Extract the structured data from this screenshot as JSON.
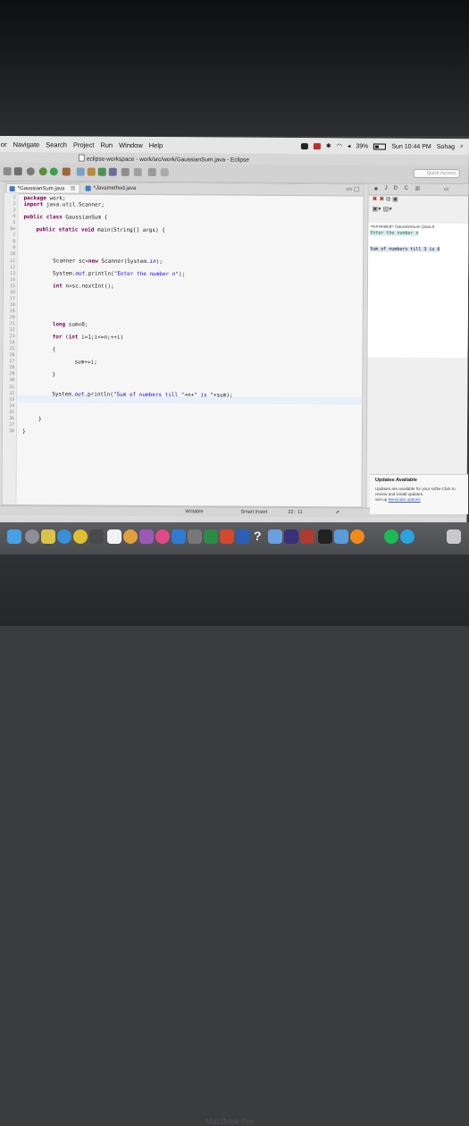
{
  "menubar": {
    "items": [
      "or",
      "Navigate",
      "Search",
      "Project",
      "Run",
      "Window",
      "Help"
    ],
    "battery": "39%",
    "clock": "Sun 10:44 PM",
    "user": "Sohag"
  },
  "window": {
    "title": "eclipse-workspace - work/src/work/GaussianSum.java - Eclipse",
    "quick_access_placeholder": "Quick Access"
  },
  "editor": {
    "tabs": [
      {
        "label": "*GaussianSum.java",
        "close": "☒",
        "active": true
      },
      {
        "label": "*Javamethod.java",
        "active": false
      }
    ],
    "line_numbers": [
      "1",
      "2",
      "3",
      "4",
      "5",
      "6⊖",
      "7",
      "8",
      "9",
      "10",
      "11",
      "12",
      "13",
      "14",
      "15",
      "16",
      "17",
      "18",
      "19",
      "20",
      "21",
      "22",
      "23",
      "24",
      "25",
      "26",
      "27",
      "28",
      "29",
      "30",
      "31",
      "32",
      "33",
      "34",
      "35",
      "36",
      "37",
      "38"
    ],
    "lines": {
      "l1": [
        "package",
        " work;"
      ],
      "l2": [
        "import",
        " java.util.Scanner;"
      ],
      "l4": [
        "public class",
        " GaussianSum {"
      ],
      "l6": [
        "public static void",
        " main(String[] args) {"
      ],
      "l10": [
        "Scanner ",
        "sc",
        "=",
        "new",
        " Scanner(System.",
        "in",
        ");"
      ],
      "l12": [
        "System.",
        "out",
        ".println(",
        "\"Enter the number n\"",
        ");"
      ],
      "l14": [
        "int",
        " n=sc.nextInt();"
      ],
      "l20": [
        "long",
        " sum=0;"
      ],
      "l22": [
        "for",
        " (",
        "int",
        " i=1;i<=n;++i)"
      ],
      "l24": "{",
      "l26": "sum+=i;",
      "l28": "}",
      "l31": [
        "System.",
        "out",
        ".println(",
        "\"Sum of numbers till \"",
        "+n+",
        "\" is \"",
        "+sum);"
      ],
      "l35": "}",
      "l37": "}"
    }
  },
  "console": {
    "tab_label": "C",
    "header": "<terminated> GaussianSum [Java A",
    "input_line": "Enter the number n",
    "output_line": "Sum of numbers till 3 is 6"
  },
  "updates": {
    "heading": "Updates Available",
    "body": "Updates are available for your softw Click to review and install updates.",
    "link_prefix": "Set up ",
    "link": "Reminder options"
  },
  "statusbar": {
    "mode1": "Writable",
    "mode2": "Smart Insert",
    "position": "22 : 11"
  },
  "bezel": {
    "label": "MacBook Pro"
  },
  "colors": {
    "keyword": "#7f0055",
    "string": "#2a00ff",
    "field": "#0000c0",
    "console_input": "#1f7a1f"
  }
}
